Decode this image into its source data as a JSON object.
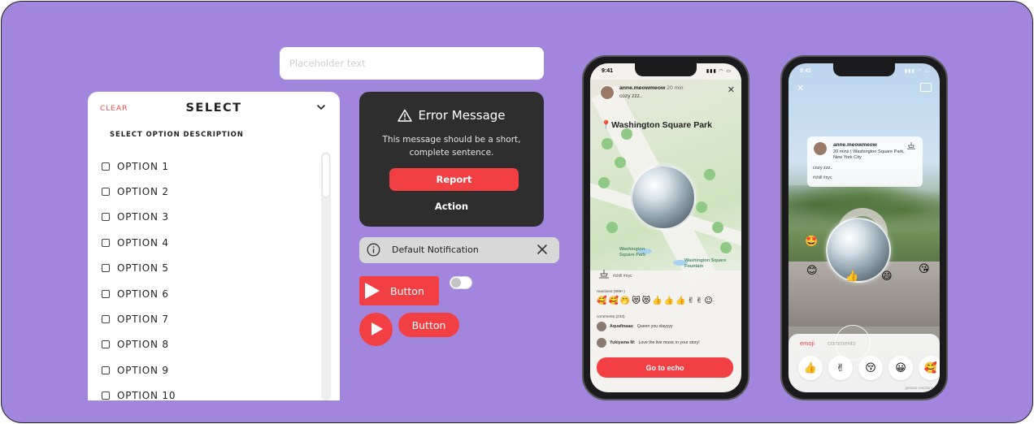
{
  "input": {
    "placeholder": "Placeholder text"
  },
  "select": {
    "clear_label": "CLEAR",
    "title": "SELECT",
    "description": "SELECT OPTION DESCRIPTION",
    "options": [
      "OPTION 1",
      "OPTION 2",
      "OPTION 3",
      "OPTION 4",
      "OPTION 5",
      "OPTION 6",
      "OPTION 7",
      "OPTION 8",
      "OPTION 9",
      "OPTION 10"
    ]
  },
  "error_card": {
    "title": "Error Message",
    "body": "This message should be a short, complete sentence.",
    "primary_label": "Report",
    "secondary_label": "Action"
  },
  "notification": {
    "text": "Default Notification"
  },
  "buttons": {
    "play_rect_label": "Button",
    "pill_label": "Button",
    "toggle_on": false
  },
  "phone1": {
    "time": "9:41",
    "username": "anne.meowmeow",
    "post_time": "20 min",
    "caption": "cozy zzz..",
    "place": "Washington Square Park",
    "map_labels": [
      "Washington Square Park",
      "Washington Square Fountain"
    ],
    "tags": "#chill #nyc",
    "reactions_label": "reactions (999+)",
    "reactions": [
      "🥰",
      "🥰",
      "🤭",
      "😻",
      "😻",
      "👍",
      "👍",
      "👍",
      "✌",
      "✌",
      "☺"
    ],
    "comments_label": "comments (233)",
    "comments": [
      {
        "name": "Aquafinaaa:",
        "text": "Queen you slayyyy"
      },
      {
        "name": "Yukiyama M:",
        "text": "Love the live music in your story!"
      }
    ],
    "cta_label": "Go to echo"
  },
  "phone2": {
    "time": "9:41",
    "card": {
      "username": "anne.meowmeow",
      "meta": "20 mins | Washington Square Park, New York City",
      "caption": "cozy zzz..",
      "tags": "#chill #nyc"
    },
    "floating_emojis": [
      "🤩",
      "😊",
      "👍",
      "😄",
      "😘"
    ],
    "tab_emoji": "emoji",
    "tab_comments": "comments",
    "emoji_buttons": [
      "👍",
      "✌",
      "😚",
      "😀",
      "🥰"
    ],
    "footer": "gesture reactions"
  },
  "colors": {
    "background": "#a285dd",
    "accent": "#f23f43",
    "error_card": "#2e2e2e"
  }
}
